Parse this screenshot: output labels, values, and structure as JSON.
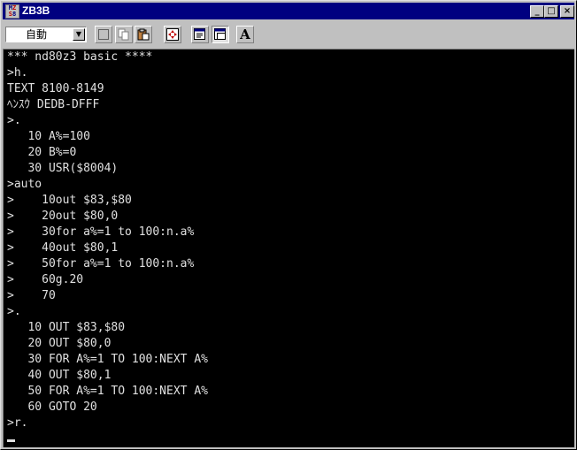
{
  "window": {
    "title": "ZB3B"
  },
  "titlebar": {
    "minimize": "_",
    "maximize": "□",
    "close": "×"
  },
  "toolbar": {
    "combo_value": "自動",
    "font_button_label": "A",
    "tools": [
      "select-icon",
      "copy-icon",
      "paste-icon",
      "fullscreen-icon",
      "properties-icon",
      "background-icon",
      "font-icon"
    ]
  },
  "console": {
    "lines": [
      "*** nd80z3 basic ****",
      ">h.",
      "TEXT 8100-8149",
      "ﾍﾝｽｳ DEDB-DFFF",
      ">.",
      "   10 A%=100",
      "   20 B%=0",
      "   30 USR($8004)",
      ">auto",
      ">    10out $83,$80",
      ">    20out $80,0",
      ">    30for a%=1 to 100:n.a%",
      ">    40out $80,1",
      ">    50for a%=1 to 100:n.a%",
      ">    60g.20",
      ">    70",
      ">.",
      "   10 OUT $83,$80",
      "   20 OUT $80,0",
      "   30 FOR A%=1 TO 100:NEXT A%",
      "   40 OUT $80,1",
      "   50 FOR A%=1 TO 100:NEXT A%",
      "   60 GOTO 20",
      ">r."
    ]
  }
}
